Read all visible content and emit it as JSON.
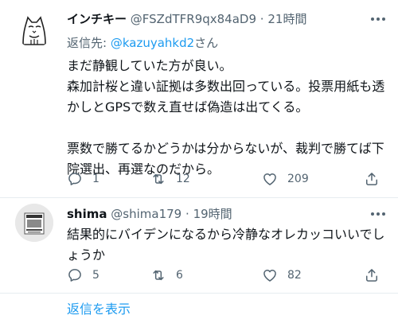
{
  "tweet1": {
    "display_name": "インチキー",
    "handle": "@FSZdTFR9qx84aD9",
    "separator": "·",
    "time": "21時間",
    "reply_prefix": "返信先: ",
    "reply_mention": "@kazuyahkd2",
    "reply_suffix": "さん",
    "text_lines": [
      "まだ静観していた方が良い。",
      "森加計桜と違い証拠は多数出回っている。投票用紙も透",
      "かしとGPSで数え直せば偽造は出てくる。",
      "",
      "票数で勝てるかどうかは分からないが、裁判で勝てば下",
      "院選出、再選なのだから。"
    ],
    "replies": "1",
    "retweets": "12",
    "likes": "209"
  },
  "tweet2": {
    "display_name": "shima",
    "handle": "@shima179",
    "separator": "·",
    "time": "19時間",
    "text_lines": [
      "結果的にバイデンになるから冷静なオレカッコいいでし",
      "ょうか"
    ],
    "replies": "5",
    "retweets": "6",
    "likes": "82"
  },
  "show_replies_label": "返信を表示",
  "colors": {
    "accent": "#1d9bf0",
    "secondary_text": "#536471",
    "primary_text": "#0f1419",
    "divider": "#e6ecf0"
  },
  "icons": {
    "reply": "speech-bubble",
    "retweet": "retweet-arrows",
    "like": "heart-outline",
    "share": "share-arrow",
    "more": "three-dots"
  }
}
